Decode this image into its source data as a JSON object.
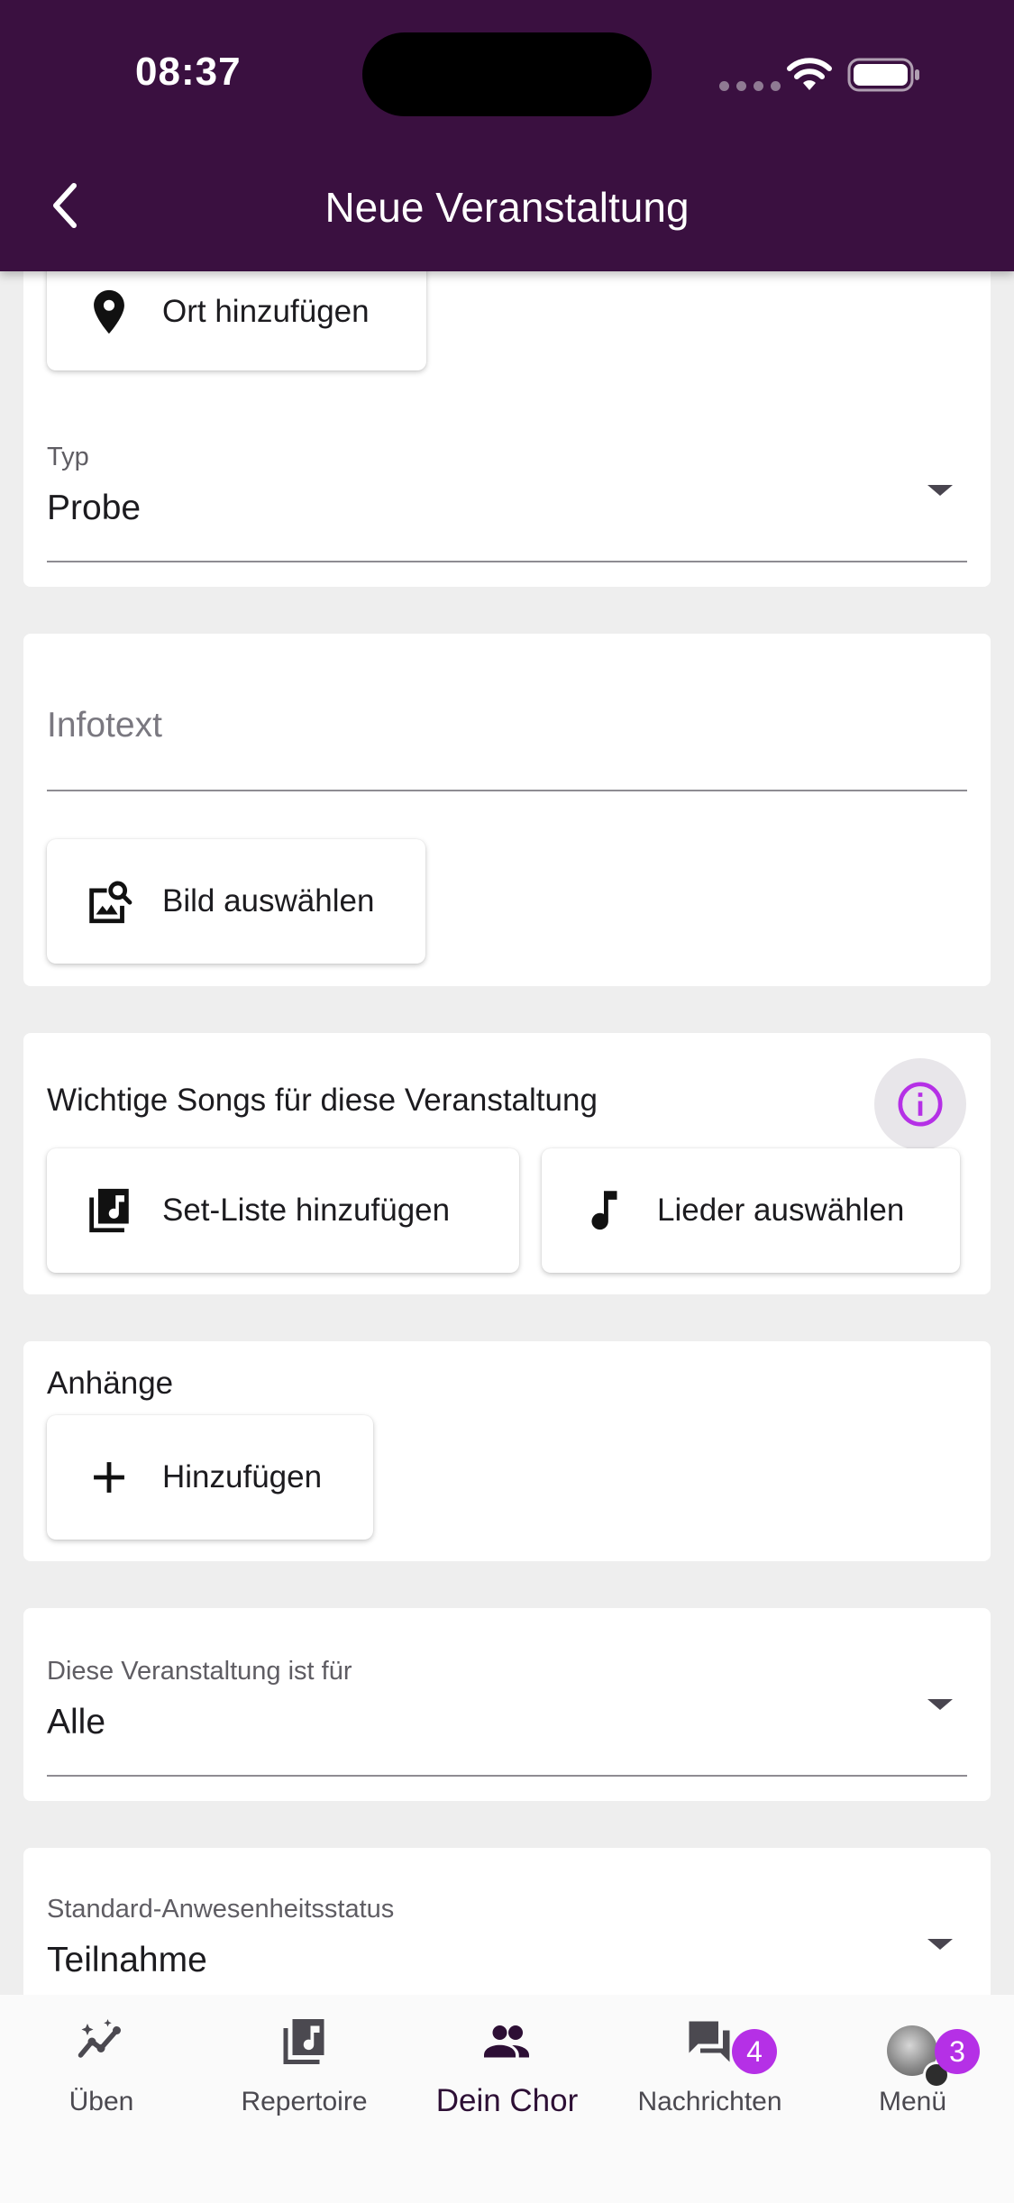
{
  "status_bar": {
    "time": "08:37"
  },
  "header": {
    "title": "Neue Veranstaltung"
  },
  "location_card": {
    "add_location_label": "Ort hinzufügen",
    "type_label": "Typ",
    "type_value": "Probe"
  },
  "info_card": {
    "infotext_placeholder": "Infotext",
    "choose_image_label": "Bild auswählen"
  },
  "songs_card": {
    "title": "Wichtige Songs für diese Veranstaltung",
    "add_setlist_label": "Set-Liste hinzufügen",
    "choose_songs_label": "Lieder auswählen"
  },
  "attachments_card": {
    "title": "Anhänge",
    "add_label": "Hinzufügen"
  },
  "audience_card": {
    "label": "Diese Veranstaltung ist für",
    "value": "Alle"
  },
  "attendance_card": {
    "label": "Standard-Anwesenheitsstatus",
    "value": "Teilnahme"
  },
  "bottom_nav": {
    "items": [
      {
        "label": "Üben",
        "icon": "practice-icon"
      },
      {
        "label": "Repertoire",
        "icon": "music-library-icon"
      },
      {
        "label": "Dein Chor",
        "icon": "group-icon",
        "active": true
      },
      {
        "label": "Nachrichten",
        "icon": "chat-icon",
        "badge": "4"
      },
      {
        "label": "Menü",
        "icon": "avatar",
        "badge": "3"
      }
    ]
  },
  "colors": {
    "header_bg": "#3a1040",
    "accent": "#b530e6",
    "background": "#eeeeee"
  }
}
